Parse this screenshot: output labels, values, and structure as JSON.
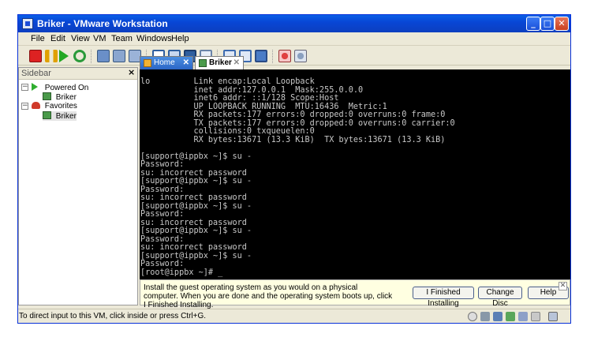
{
  "window": {
    "title": "Briker - VMware Workstation"
  },
  "window_buttons": {
    "minimize": "_",
    "maximize": "□",
    "close": "✕"
  },
  "menu": [
    "File",
    "Edit",
    "View",
    "VM",
    "Team",
    "Windows",
    "Help"
  ],
  "toolbar": {
    "icons": [
      "power-off-icon",
      "suspend-icon",
      "power-on-icon",
      "reset-icon",
      "snapshot-icon",
      "revert-snapshot-icon",
      "snapshot-manager-icon",
      "normal-view-icon",
      "quick-switch-icon",
      "full-screen-icon",
      "summary-view-icon",
      "console-view-icon",
      "thumbnail-view-icon",
      "appliance-view-icon",
      "team-icon",
      "clone-icon"
    ]
  },
  "sidebar": {
    "label": "Sidebar",
    "close": "×",
    "tree": {
      "powered_on": "Powered On",
      "powered_on_vm": "Briker",
      "favorites": "Favorites",
      "favorites_vm": "Briker"
    }
  },
  "tabs": [
    {
      "label": "Home",
      "close": "✕"
    },
    {
      "label": "Briker",
      "close": "✕"
    }
  ],
  "console": {
    "lines": [
      "lo         Link encap:Local Loopback",
      "           inet addr:127.0.0.1  Mask:255.0.0.0",
      "           inet6 addr: ::1/128 Scope:Host",
      "           UP LOOPBACK RUNNING  MTU:16436  Metric:1",
      "           RX packets:177 errors:0 dropped:0 overruns:0 frame:0",
      "           TX packets:177 errors:0 dropped:0 overruns:0 carrier:0",
      "           collisions:0 txqueuelen:0",
      "           RX bytes:13671 (13.3 KiB)  TX bytes:13671 (13.3 KiB)",
      "",
      "[support@ippbx ~]$ su -",
      "Password:",
      "su: incorrect password",
      "[support@ippbx ~]$ su -",
      "Password:",
      "su: incorrect password",
      "[support@ippbx ~]$ su -",
      "Password:",
      "su: incorrect password",
      "[support@ippbx ~]$ su -",
      "Password:",
      "su: incorrect password",
      "[support@ippbx ~]$ su -",
      "Password:",
      "[root@ippbx ~]# _"
    ]
  },
  "hint": {
    "text": "Install the guest operating system as you would on a physical computer. When you are done and the operating system boots up, click I Finished Installing.",
    "buttons": [
      "I Finished Installing",
      "Change Disc",
      "Help"
    ],
    "close": "✕"
  },
  "status": {
    "text": "To direct input to this VM, click inside or press Ctrl+G.",
    "icons": [
      "cd-rom-icon",
      "hard-disk-icon",
      "floppy-icon",
      "network-icon",
      "sound-icon",
      "usb-icon",
      "message-icon"
    ]
  },
  "colors": {
    "titlebar": "#0a5fe6",
    "console_bg": "#000000",
    "console_fg": "#c8c8c8",
    "hint_bg": "#ffffe1",
    "power_on_green": "#2fae2f",
    "favorites_red": "#d03a2a"
  }
}
